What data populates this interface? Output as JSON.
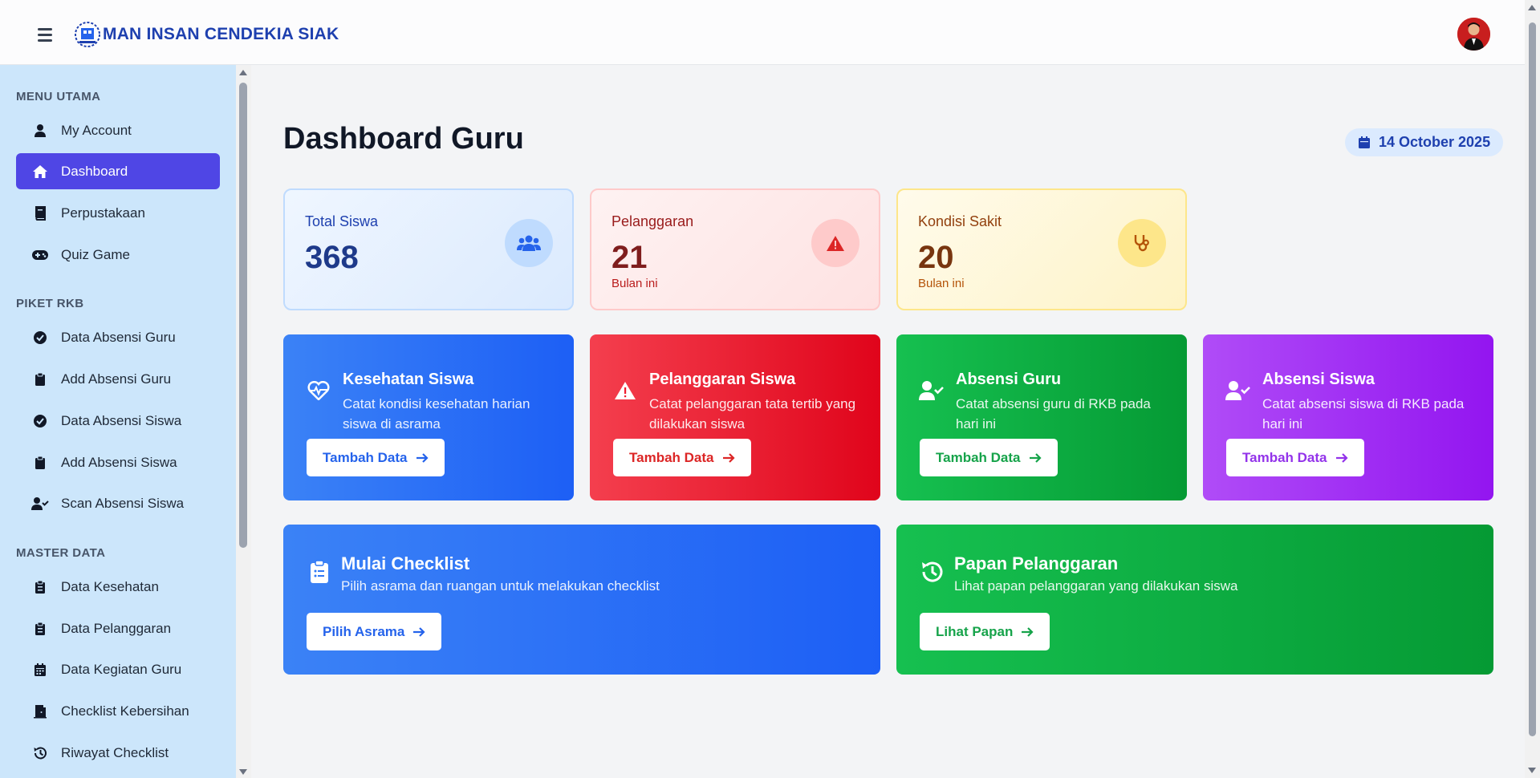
{
  "header": {
    "brand": "MAN INSAN CENDEKIA SIAK",
    "menu_icon": "hamburger-icon",
    "logo_icon": "school-logo",
    "avatar": "user-avatar"
  },
  "sidebar": {
    "sections": [
      {
        "title": "MENU UTAMA",
        "items": [
          {
            "label": "My Account",
            "icon": "user-icon"
          },
          {
            "label": "Dashboard",
            "icon": "home-icon",
            "active": true
          },
          {
            "label": "Perpustakaan",
            "icon": "book-icon"
          },
          {
            "label": "Quiz Game",
            "icon": "gamepad-icon"
          }
        ]
      },
      {
        "title": "PIKET RKB",
        "items": [
          {
            "label": "Data Absensi Guru",
            "icon": "check-circle-icon"
          },
          {
            "label": "Add Absensi Guru",
            "icon": "clipboard-icon"
          },
          {
            "label": "Data Absensi Siswa",
            "icon": "check-circle-icon"
          },
          {
            "label": "Add Absensi Siswa",
            "icon": "clipboard-icon"
          },
          {
            "label": "Scan Absensi Siswa",
            "icon": "user-check-icon"
          }
        ]
      },
      {
        "title": "MASTER DATA",
        "items": [
          {
            "label": "Data Kesehatan",
            "icon": "clipboard-list-icon"
          },
          {
            "label": "Data Pelanggaran",
            "icon": "clipboard-list-icon"
          },
          {
            "label": "Data Kegiatan Guru",
            "icon": "calendar-icon"
          },
          {
            "label": "Checklist Kebersihan",
            "icon": "door-icon"
          },
          {
            "label": "Riwayat Checklist",
            "icon": "history-icon"
          }
        ]
      }
    ]
  },
  "main": {
    "title": "Dashboard Guru",
    "date": "14 October 2025",
    "stats": [
      {
        "label": "Total Siswa",
        "value": "368",
        "sub": "",
        "icon": "users-icon"
      },
      {
        "label": "Pelanggaran",
        "value": "21",
        "sub": "Bulan ini",
        "icon": "warning-icon"
      },
      {
        "label": "Kondisi Sakit",
        "value": "20",
        "sub": "Bulan ini",
        "icon": "stethoscope-icon"
      }
    ],
    "actions": [
      {
        "title": "Kesehatan Siswa",
        "desc": "Catat kondisi kesehatan harian siswa di asrama",
        "button": "Tambah Data",
        "icon": "heart-pulse-icon"
      },
      {
        "title": "Pelanggaran Siswa",
        "desc": "Catat pelanggaran tata tertib yang dilakukan siswa",
        "button": "Tambah Data",
        "icon": "warning-icon"
      },
      {
        "title": "Absensi Guru",
        "desc": "Catat absensi guru di RKB pada hari ini",
        "button": "Tambah Data",
        "icon": "user-check-icon"
      },
      {
        "title": "Absensi Siswa",
        "desc": "Catat absensi siswa di RKB pada hari ini",
        "button": "Tambah Data",
        "icon": "user-check-icon"
      }
    ],
    "wide_actions": [
      {
        "title": "Mulai Checklist",
        "desc": "Pilih asrama dan ruangan untuk melakukan checklist",
        "button": "Pilih Asrama",
        "icon": "clipboard-list-icon"
      },
      {
        "title": "Papan Pelanggaran",
        "desc": "Lihat papan pelanggaran yang dilakukan siswa",
        "button": "Lihat Papan",
        "icon": "history-icon"
      }
    ]
  }
}
